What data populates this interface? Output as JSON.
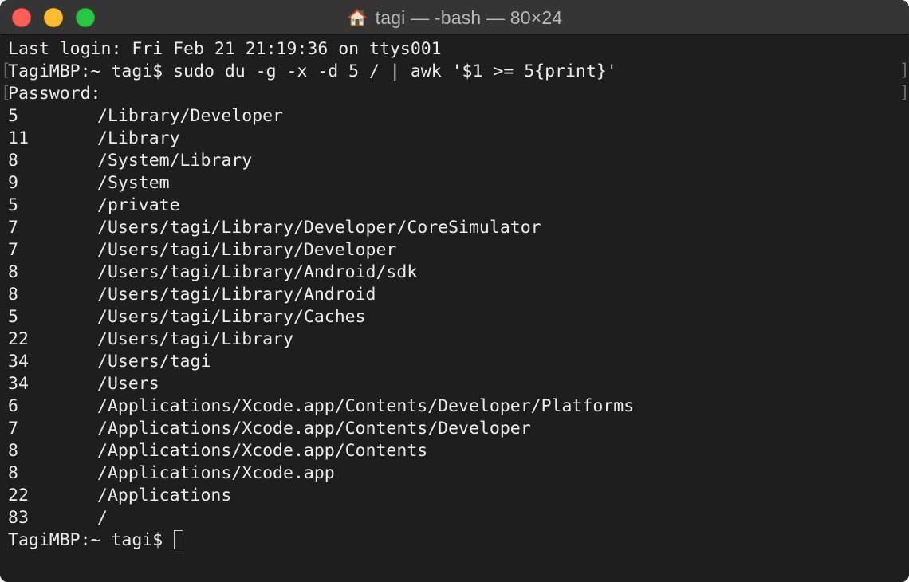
{
  "window": {
    "title": "tagi — -bash — 80×24",
    "title_icon": "house-icon"
  },
  "terminal": {
    "last_login": "Last login: Fri Feb 21 21:19:36 on ttys001",
    "command_prompt": "TagiMBP:~ tagi$ ",
    "command": "sudo du -g -x -d 5 / | awk '$1 >= 5{print}'",
    "password_prompt": "Password:",
    "rows": [
      {
        "size": "5",
        "path": "/Library/Developer"
      },
      {
        "size": "11",
        "path": "/Library"
      },
      {
        "size": "8",
        "path": "/System/Library"
      },
      {
        "size": "9",
        "path": "/System"
      },
      {
        "size": "5",
        "path": "/private"
      },
      {
        "size": "7",
        "path": "/Users/tagi/Library/Developer/CoreSimulator"
      },
      {
        "size": "7",
        "path": "/Users/tagi/Library/Developer"
      },
      {
        "size": "8",
        "path": "/Users/tagi/Library/Android/sdk"
      },
      {
        "size": "8",
        "path": "/Users/tagi/Library/Android"
      },
      {
        "size": "5",
        "path": "/Users/tagi/Library/Caches"
      },
      {
        "size": "22",
        "path": "/Users/tagi/Library"
      },
      {
        "size": "34",
        "path": "/Users/tagi"
      },
      {
        "size": "34",
        "path": "/Users"
      },
      {
        "size": "6",
        "path": "/Applications/Xcode.app/Contents/Developer/Platforms"
      },
      {
        "size": "7",
        "path": "/Applications/Xcode.app/Contents/Developer"
      },
      {
        "size": "8",
        "path": "/Applications/Xcode.app/Contents"
      },
      {
        "size": "8",
        "path": "/Applications/Xcode.app"
      },
      {
        "size": "22",
        "path": "/Applications"
      },
      {
        "size": "83",
        "path": "/"
      }
    ],
    "final_prompt": "TagiMBP:~ tagi$ "
  },
  "colors": {
    "background": "#1e1e1e",
    "text": "#ececec",
    "titlebar": "#353535",
    "close": "#fe5f57",
    "minimize": "#febc2e",
    "maximize": "#28c840"
  }
}
